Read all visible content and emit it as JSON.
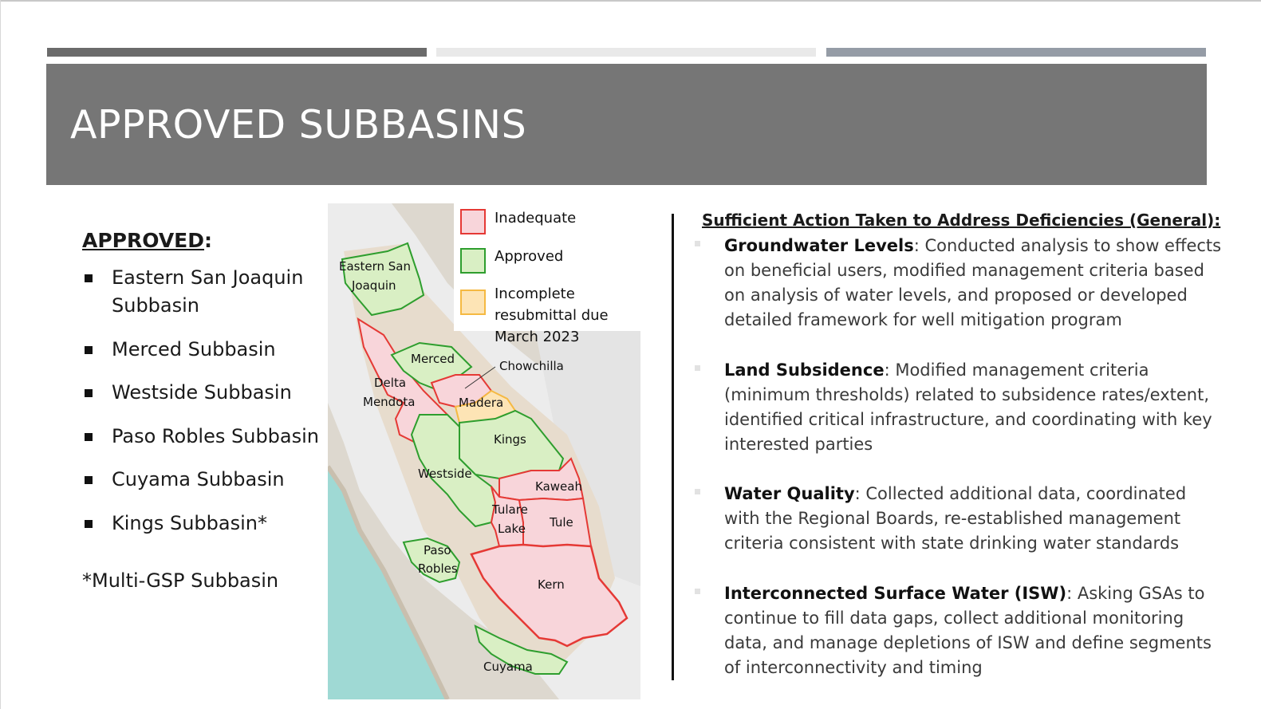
{
  "slide": {
    "title": "APPROVED SUBBASINS"
  },
  "left": {
    "heading": "APPROVED",
    "heading_suffix": ":",
    "items": [
      "Eastern San Joaquin Subbasin",
      "Merced Subbasin",
      "Westside Subbasin",
      "Paso Robles Subbasin",
      "Cuyama Subbasin",
      "Kings Subbasin*"
    ],
    "footnote": "*Multi-GSP Subbasin"
  },
  "map": {
    "legend": [
      {
        "label": "Inadequate",
        "color": "#e53935",
        "fill": "#f8d5da"
      },
      {
        "label": "Approved",
        "color": "#2e9e2e",
        "fill": "#d9efc4"
      },
      {
        "label": "Incomplete resubmittal due March 2023",
        "color": "#f5b942",
        "fill": "#fde4b5"
      }
    ],
    "labels": {
      "eastern_san_joaquin": "Eastern San",
      "eastern_san_joaquin_2": "Joaquin",
      "merced": "Merced",
      "chowchilla": "Chowchilla",
      "delta": "Delta",
      "mendota": "Mendota",
      "madera": "Madera",
      "kings": "Kings",
      "westside": "Westside",
      "kaweah": "Kaweah",
      "tulare": "Tulare",
      "lake": "Lake",
      "tule": "Tule",
      "paso": "Paso",
      "robles": "Robles",
      "kern": "Kern",
      "cuyama": "Cuyama"
    }
  },
  "right": {
    "heading": "Sufficient Action Taken to Address Deficiencies (General):",
    "sections": [
      {
        "title": "Groundwater Levels",
        "body": ": Conducted analysis to show effects on beneficial users, modified management criteria based on analysis of water levels, and proposed or developed detailed framework for well mitigation program"
      },
      {
        "title": "Land Subsidence",
        "body": ": Modified management criteria (minimum thresholds) related to subsidence rates/extent, identified critical infrastructure, and coordinating with key interested parties"
      },
      {
        "title": "Water Quality",
        "body": ": Collected additional data, coordinated with the Regional Boards, re-established management criteria consistent with state drinking water standards"
      },
      {
        "title": "Interconnected Surface Water (ISW)",
        "body": ": Asking GSAs to continue to fill data gaps, collect additional monitoring data, and manage depletions of ISW and define segments of interconnectivity and timing"
      }
    ]
  }
}
